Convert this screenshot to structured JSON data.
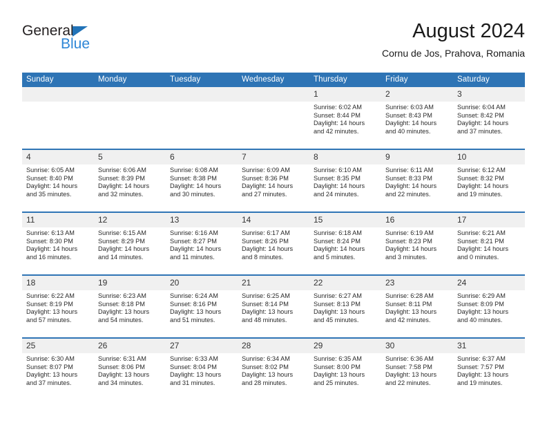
{
  "brand": {
    "word_one": "General",
    "word_two": "Blue",
    "triangle_icon": "triangle-icon"
  },
  "header": {
    "month_title": "August 2024",
    "location": "Cornu de Jos, Prahova, Romania"
  },
  "colors": {
    "header_blue": "#2E74B5",
    "brand_blue": "#2E86D6",
    "date_band_gray": "#F0F0F0",
    "text_dark": "#1A1A1A"
  },
  "calendar": {
    "weekday_headers": [
      "Sunday",
      "Monday",
      "Tuesday",
      "Wednesday",
      "Thursday",
      "Friday",
      "Saturday"
    ],
    "weeks": [
      {
        "dates": [
          "",
          "",
          "",
          "",
          "1",
          "2",
          "3"
        ],
        "cells": [
          {
            "day": "",
            "sunrise": "",
            "sunset": "",
            "daylight_line1": "",
            "daylight_line2": ""
          },
          {
            "day": "",
            "sunrise": "",
            "sunset": "",
            "daylight_line1": "",
            "daylight_line2": ""
          },
          {
            "day": "",
            "sunrise": "",
            "sunset": "",
            "daylight_line1": "",
            "daylight_line2": ""
          },
          {
            "day": "",
            "sunrise": "",
            "sunset": "",
            "daylight_line1": "",
            "daylight_line2": ""
          },
          {
            "day": "1",
            "sunrise": "Sunrise: 6:02 AM",
            "sunset": "Sunset: 8:44 PM",
            "daylight_line1": "Daylight: 14 hours",
            "daylight_line2": "and 42 minutes."
          },
          {
            "day": "2",
            "sunrise": "Sunrise: 6:03 AM",
            "sunset": "Sunset: 8:43 PM",
            "daylight_line1": "Daylight: 14 hours",
            "daylight_line2": "and 40 minutes."
          },
          {
            "day": "3",
            "sunrise": "Sunrise: 6:04 AM",
            "sunset": "Sunset: 8:42 PM",
            "daylight_line1": "Daylight: 14 hours",
            "daylight_line2": "and 37 minutes."
          }
        ]
      },
      {
        "dates": [
          "4",
          "5",
          "6",
          "7",
          "8",
          "9",
          "10"
        ],
        "cells": [
          {
            "day": "4",
            "sunrise": "Sunrise: 6:05 AM",
            "sunset": "Sunset: 8:40 PM",
            "daylight_line1": "Daylight: 14 hours",
            "daylight_line2": "and 35 minutes."
          },
          {
            "day": "5",
            "sunrise": "Sunrise: 6:06 AM",
            "sunset": "Sunset: 8:39 PM",
            "daylight_line1": "Daylight: 14 hours",
            "daylight_line2": "and 32 minutes."
          },
          {
            "day": "6",
            "sunrise": "Sunrise: 6:08 AM",
            "sunset": "Sunset: 8:38 PM",
            "daylight_line1": "Daylight: 14 hours",
            "daylight_line2": "and 30 minutes."
          },
          {
            "day": "7",
            "sunrise": "Sunrise: 6:09 AM",
            "sunset": "Sunset: 8:36 PM",
            "daylight_line1": "Daylight: 14 hours",
            "daylight_line2": "and 27 minutes."
          },
          {
            "day": "8",
            "sunrise": "Sunrise: 6:10 AM",
            "sunset": "Sunset: 8:35 PM",
            "daylight_line1": "Daylight: 14 hours",
            "daylight_line2": "and 24 minutes."
          },
          {
            "day": "9",
            "sunrise": "Sunrise: 6:11 AM",
            "sunset": "Sunset: 8:33 PM",
            "daylight_line1": "Daylight: 14 hours",
            "daylight_line2": "and 22 minutes."
          },
          {
            "day": "10",
            "sunrise": "Sunrise: 6:12 AM",
            "sunset": "Sunset: 8:32 PM",
            "daylight_line1": "Daylight: 14 hours",
            "daylight_line2": "and 19 minutes."
          }
        ]
      },
      {
        "dates": [
          "11",
          "12",
          "13",
          "14",
          "15",
          "16",
          "17"
        ],
        "cells": [
          {
            "day": "11",
            "sunrise": "Sunrise: 6:13 AM",
            "sunset": "Sunset: 8:30 PM",
            "daylight_line1": "Daylight: 14 hours",
            "daylight_line2": "and 16 minutes."
          },
          {
            "day": "12",
            "sunrise": "Sunrise: 6:15 AM",
            "sunset": "Sunset: 8:29 PM",
            "daylight_line1": "Daylight: 14 hours",
            "daylight_line2": "and 14 minutes."
          },
          {
            "day": "13",
            "sunrise": "Sunrise: 6:16 AM",
            "sunset": "Sunset: 8:27 PM",
            "daylight_line1": "Daylight: 14 hours",
            "daylight_line2": "and 11 minutes."
          },
          {
            "day": "14",
            "sunrise": "Sunrise: 6:17 AM",
            "sunset": "Sunset: 8:26 PM",
            "daylight_line1": "Daylight: 14 hours",
            "daylight_line2": "and 8 minutes."
          },
          {
            "day": "15",
            "sunrise": "Sunrise: 6:18 AM",
            "sunset": "Sunset: 8:24 PM",
            "daylight_line1": "Daylight: 14 hours",
            "daylight_line2": "and 5 minutes."
          },
          {
            "day": "16",
            "sunrise": "Sunrise: 6:19 AM",
            "sunset": "Sunset: 8:23 PM",
            "daylight_line1": "Daylight: 14 hours",
            "daylight_line2": "and 3 minutes."
          },
          {
            "day": "17",
            "sunrise": "Sunrise: 6:21 AM",
            "sunset": "Sunset: 8:21 PM",
            "daylight_line1": "Daylight: 14 hours",
            "daylight_line2": "and 0 minutes."
          }
        ]
      },
      {
        "dates": [
          "18",
          "19",
          "20",
          "21",
          "22",
          "23",
          "24"
        ],
        "cells": [
          {
            "day": "18",
            "sunrise": "Sunrise: 6:22 AM",
            "sunset": "Sunset: 8:19 PM",
            "daylight_line1": "Daylight: 13 hours",
            "daylight_line2": "and 57 minutes."
          },
          {
            "day": "19",
            "sunrise": "Sunrise: 6:23 AM",
            "sunset": "Sunset: 8:18 PM",
            "daylight_line1": "Daylight: 13 hours",
            "daylight_line2": "and 54 minutes."
          },
          {
            "day": "20",
            "sunrise": "Sunrise: 6:24 AM",
            "sunset": "Sunset: 8:16 PM",
            "daylight_line1": "Daylight: 13 hours",
            "daylight_line2": "and 51 minutes."
          },
          {
            "day": "21",
            "sunrise": "Sunrise: 6:25 AM",
            "sunset": "Sunset: 8:14 PM",
            "daylight_line1": "Daylight: 13 hours",
            "daylight_line2": "and 48 minutes."
          },
          {
            "day": "22",
            "sunrise": "Sunrise: 6:27 AM",
            "sunset": "Sunset: 8:13 PM",
            "daylight_line1": "Daylight: 13 hours",
            "daylight_line2": "and 45 minutes."
          },
          {
            "day": "23",
            "sunrise": "Sunrise: 6:28 AM",
            "sunset": "Sunset: 8:11 PM",
            "daylight_line1": "Daylight: 13 hours",
            "daylight_line2": "and 42 minutes."
          },
          {
            "day": "24",
            "sunrise": "Sunrise: 6:29 AM",
            "sunset": "Sunset: 8:09 PM",
            "daylight_line1": "Daylight: 13 hours",
            "daylight_line2": "and 40 minutes."
          }
        ]
      },
      {
        "dates": [
          "25",
          "26",
          "27",
          "28",
          "29",
          "30",
          "31"
        ],
        "cells": [
          {
            "day": "25",
            "sunrise": "Sunrise: 6:30 AM",
            "sunset": "Sunset: 8:07 PM",
            "daylight_line1": "Daylight: 13 hours",
            "daylight_line2": "and 37 minutes."
          },
          {
            "day": "26",
            "sunrise": "Sunrise: 6:31 AM",
            "sunset": "Sunset: 8:06 PM",
            "daylight_line1": "Daylight: 13 hours",
            "daylight_line2": "and 34 minutes."
          },
          {
            "day": "27",
            "sunrise": "Sunrise: 6:33 AM",
            "sunset": "Sunset: 8:04 PM",
            "daylight_line1": "Daylight: 13 hours",
            "daylight_line2": "and 31 minutes."
          },
          {
            "day": "28",
            "sunrise": "Sunrise: 6:34 AM",
            "sunset": "Sunset: 8:02 PM",
            "daylight_line1": "Daylight: 13 hours",
            "daylight_line2": "and 28 minutes."
          },
          {
            "day": "29",
            "sunrise": "Sunrise: 6:35 AM",
            "sunset": "Sunset: 8:00 PM",
            "daylight_line1": "Daylight: 13 hours",
            "daylight_line2": "and 25 minutes."
          },
          {
            "day": "30",
            "sunrise": "Sunrise: 6:36 AM",
            "sunset": "Sunset: 7:58 PM",
            "daylight_line1": "Daylight: 13 hours",
            "daylight_line2": "and 22 minutes."
          },
          {
            "day": "31",
            "sunrise": "Sunrise: 6:37 AM",
            "sunset": "Sunset: 7:57 PM",
            "daylight_line1": "Daylight: 13 hours",
            "daylight_line2": "and 19 minutes."
          }
        ]
      }
    ]
  }
}
